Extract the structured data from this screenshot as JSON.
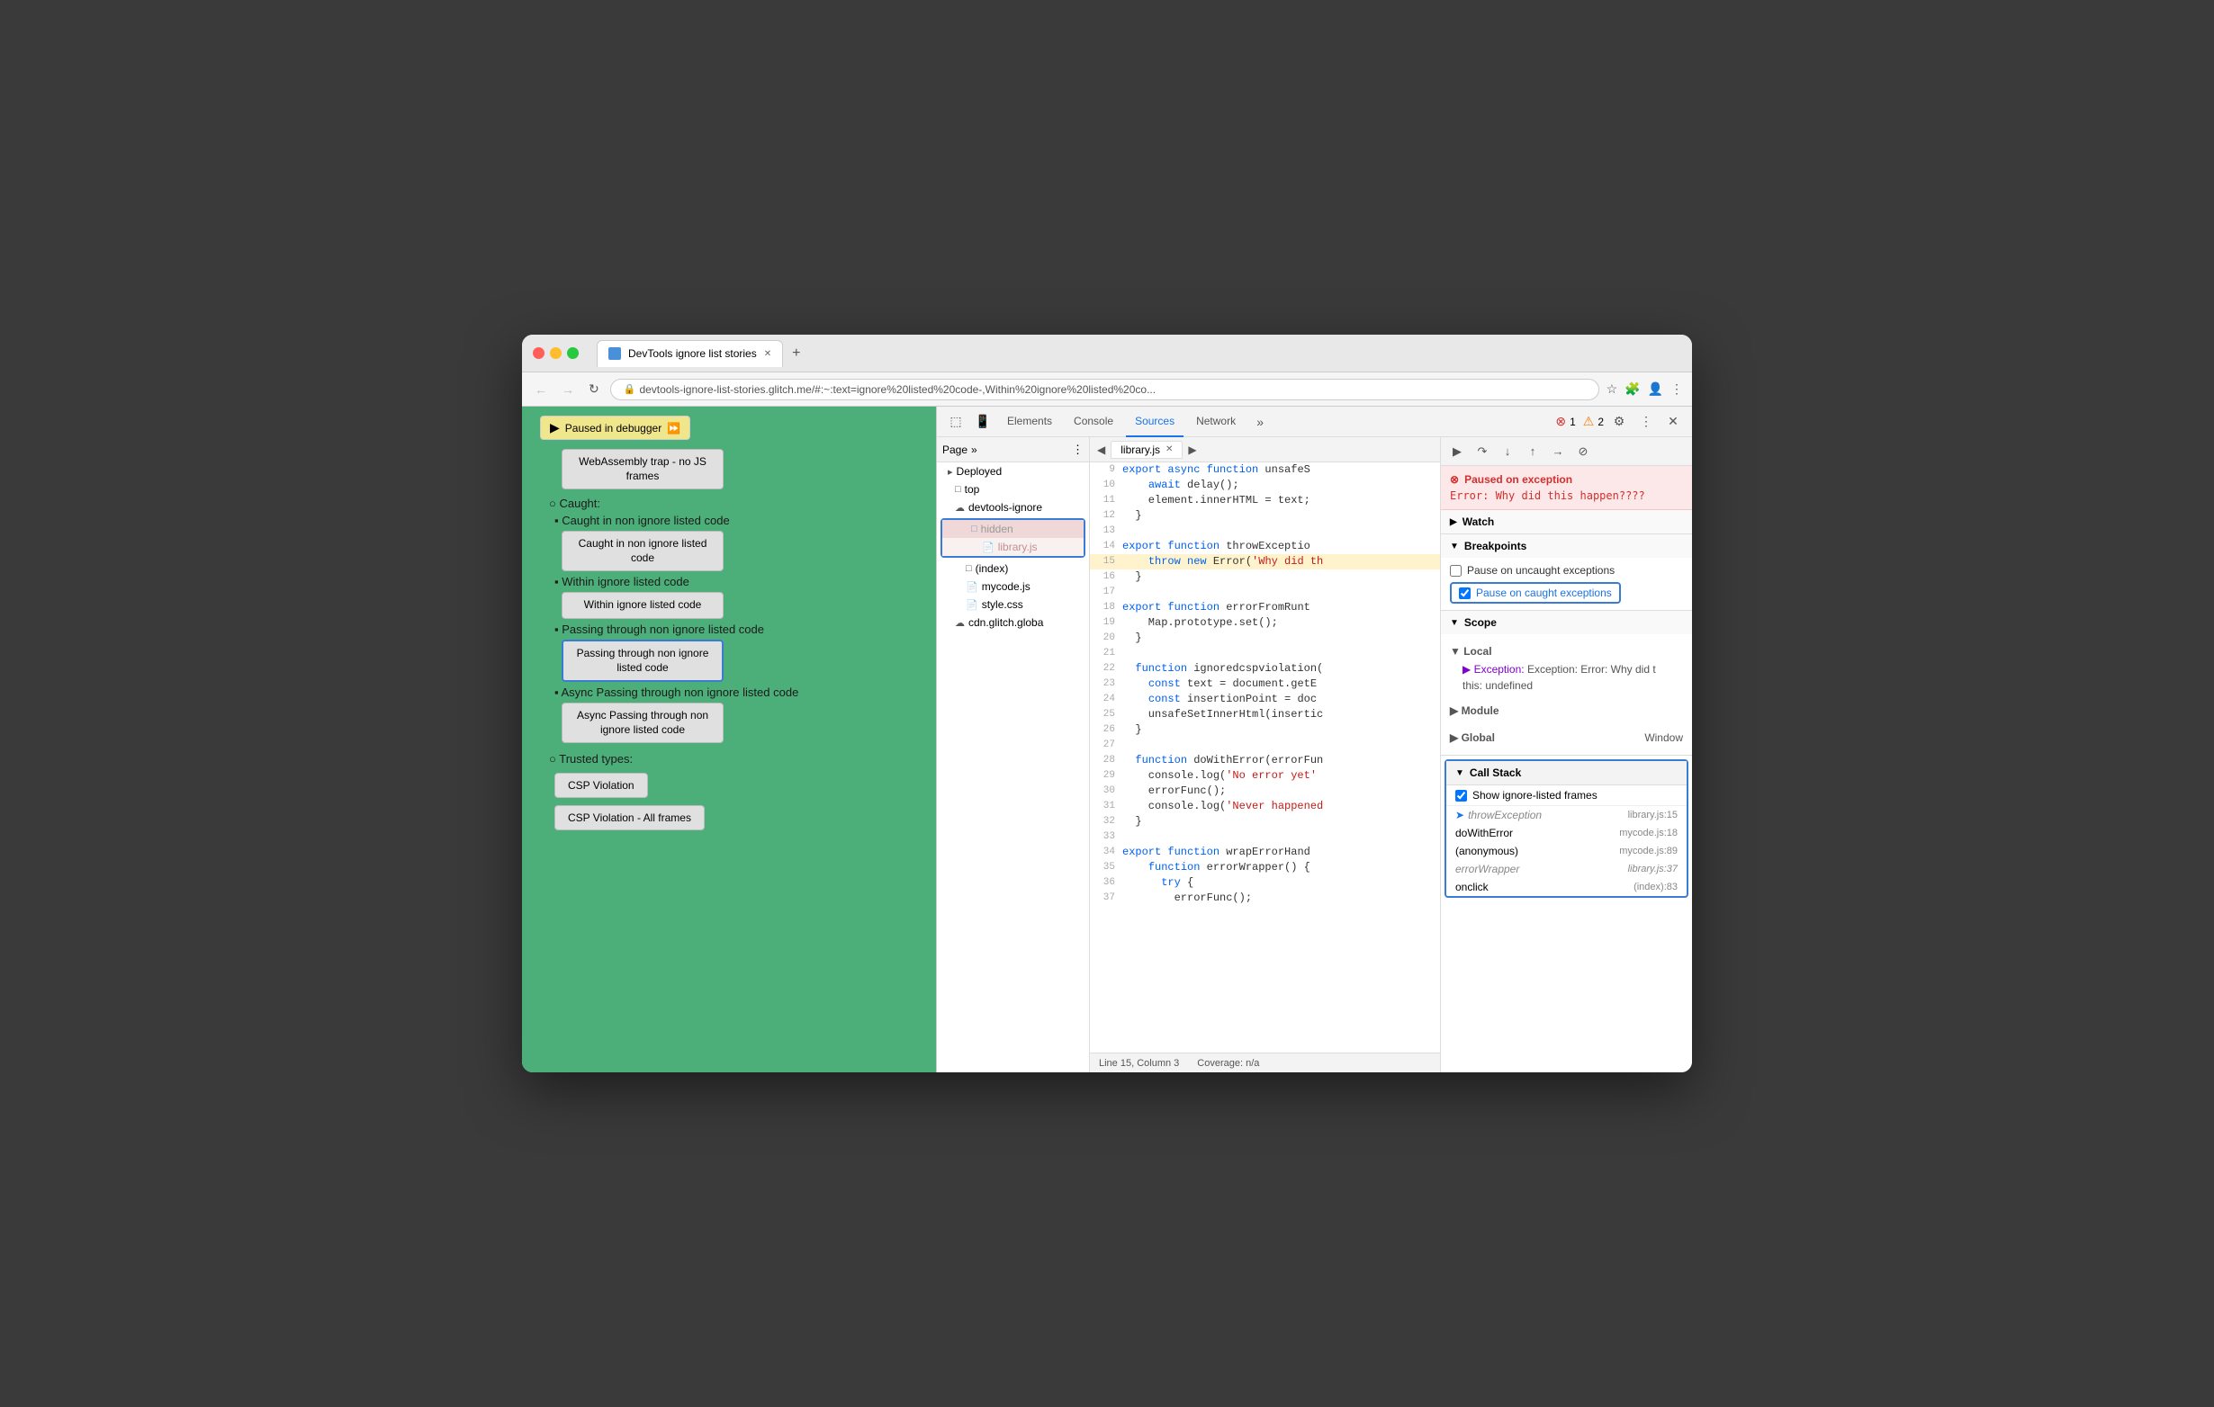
{
  "window": {
    "title": "DevTools ignore list stories",
    "url": "devtools-ignore-list-stories.glitch.me/#:~:text=ignore%20listed%20code-,Within%20ignore%20listed%20co...",
    "tab_label": "DevTools ignore list stories"
  },
  "nav": {
    "back": "←",
    "forward": "→",
    "refresh": "↻"
  },
  "debugger_banner": "Paused in debugger",
  "page": {
    "webassembly_trap": "WebAssembly trap - no JS frames",
    "caught_label": "Caught:",
    "caught_items": [
      "Caught in non ignore listed code",
      "Within ignore listed code",
      "Passing through non ignore listed code",
      "Async Passing through non ignore listed code"
    ],
    "caught_btns": [
      "Caught in non ignore listed code",
      "Within ignore listed code",
      "Passing through non ignore listed code",
      "Async Passing through non ignore listed code"
    ],
    "trusted_label": "Trusted types:",
    "trusted_btns": [
      "CSP Violation",
      "CSP Violation - All frames"
    ]
  },
  "devtools": {
    "tabs": [
      "Elements",
      "Console",
      "Sources",
      "Network"
    ],
    "active_tab": "Sources",
    "errors": "1",
    "warnings": "2",
    "file_tabs": [
      "library.js"
    ],
    "status_line": "Line 15, Column 3",
    "status_coverage": "Coverage: n/a"
  },
  "file_tree": {
    "items": [
      {
        "label": "Deployed",
        "type": "section",
        "indent": 0
      },
      {
        "label": "top",
        "type": "folder",
        "indent": 1
      },
      {
        "label": "devtools-ignore",
        "type": "cloud",
        "indent": 1
      },
      {
        "label": "hidden",
        "type": "folder",
        "indent": 2,
        "highlighted": true
      },
      {
        "label": "library.js",
        "type": "js",
        "indent": 3,
        "highlighted": true,
        "dimmed": true
      },
      {
        "label": "(index)",
        "type": "file",
        "indent": 2
      },
      {
        "label": "mycode.js",
        "type": "js-red",
        "indent": 2
      },
      {
        "label": "style.css",
        "type": "css",
        "indent": 2
      },
      {
        "label": "cdn.glitch.globa",
        "type": "cloud",
        "indent": 1
      }
    ]
  },
  "source": {
    "filename": "library.js",
    "lines": [
      {
        "num": 9,
        "code": "  export async function unsafeS",
        "highlight": false
      },
      {
        "num": 10,
        "code": "    await delay();",
        "highlight": false
      },
      {
        "num": 11,
        "code": "    element.innerHTML = text;",
        "highlight": false
      },
      {
        "num": 12,
        "code": "  }",
        "highlight": false
      },
      {
        "num": 13,
        "code": "",
        "highlight": false
      },
      {
        "num": 14,
        "code": "  export function throwExceptio",
        "highlight": false
      },
      {
        "num": 15,
        "code": "    throw new Error('Why did th",
        "highlight": true
      },
      {
        "num": 16,
        "code": "  }",
        "highlight": false
      },
      {
        "num": 17,
        "code": "",
        "highlight": false
      },
      {
        "num": 18,
        "code": "  export function errorFromRunt",
        "highlight": false
      },
      {
        "num": 19,
        "code": "    Map.prototype.set();",
        "highlight": false
      },
      {
        "num": 20,
        "code": "  }",
        "highlight": false
      },
      {
        "num": 21,
        "code": "",
        "highlight": false
      },
      {
        "num": 22,
        "code": "  function ignoredcspviolation(",
        "highlight": false
      },
      {
        "num": 23,
        "code": "    const text = document.getE",
        "highlight": false
      },
      {
        "num": 24,
        "code": "    const insertionPoint = doc",
        "highlight": false
      },
      {
        "num": 25,
        "code": "    unsafeSetInnerHtml(insertic",
        "highlight": false
      },
      {
        "num": 26,
        "code": "  }",
        "highlight": false
      },
      {
        "num": 27,
        "code": "",
        "highlight": false
      },
      {
        "num": 28,
        "code": "  function doWithError(errorFun",
        "highlight": false
      },
      {
        "num": 29,
        "code": "    console.log('No error yet'",
        "highlight": false
      },
      {
        "num": 30,
        "code": "    errorFunc();",
        "highlight": false
      },
      {
        "num": 31,
        "code": "    console.log('Never happened",
        "highlight": false
      },
      {
        "num": 32,
        "code": "  }",
        "highlight": false
      },
      {
        "num": 33,
        "code": "",
        "highlight": false
      },
      {
        "num": 34,
        "code": "  export function wrapErrorHand",
        "highlight": false
      },
      {
        "num": 35,
        "code": "    function errorWrapper() {",
        "highlight": false
      },
      {
        "num": 36,
        "code": "      try {",
        "highlight": false
      },
      {
        "num": 37,
        "code": "        errorFunc();",
        "highlight": false
      }
    ]
  },
  "debug": {
    "exception_title": "Paused on exception",
    "exception_msg": "Error: Why did this happen????",
    "sections": {
      "watch": "Watch",
      "breakpoints": "Breakpoints",
      "pause_uncaught": "Pause on uncaught exceptions",
      "pause_caught": "Pause on caught exceptions",
      "pause_caught_checked": true,
      "pause_uncaught_checked": false,
      "scope": "Scope",
      "local": "Local",
      "exception_scope": "Exception: Error: Why did t",
      "this_val": "this: undefined",
      "module": "Module",
      "global": "Global",
      "global_val": "Window"
    },
    "callstack": {
      "label": "Call Stack",
      "show_ignored": "Show ignore-listed frames",
      "show_ignored_checked": true,
      "frames": [
        {
          "fn": "throwException",
          "loc": "library.js:15",
          "type": "ignored",
          "active": true
        },
        {
          "fn": "doWithError",
          "loc": "mycode.js:18",
          "type": "normal"
        },
        {
          "fn": "(anonymous)",
          "loc": "mycode.js:89",
          "type": "normal"
        },
        {
          "fn": "errorWrapper",
          "loc": "library.js:37",
          "type": "ignored"
        },
        {
          "fn": "onclick",
          "loc": "(index):83",
          "type": "normal"
        }
      ]
    }
  }
}
